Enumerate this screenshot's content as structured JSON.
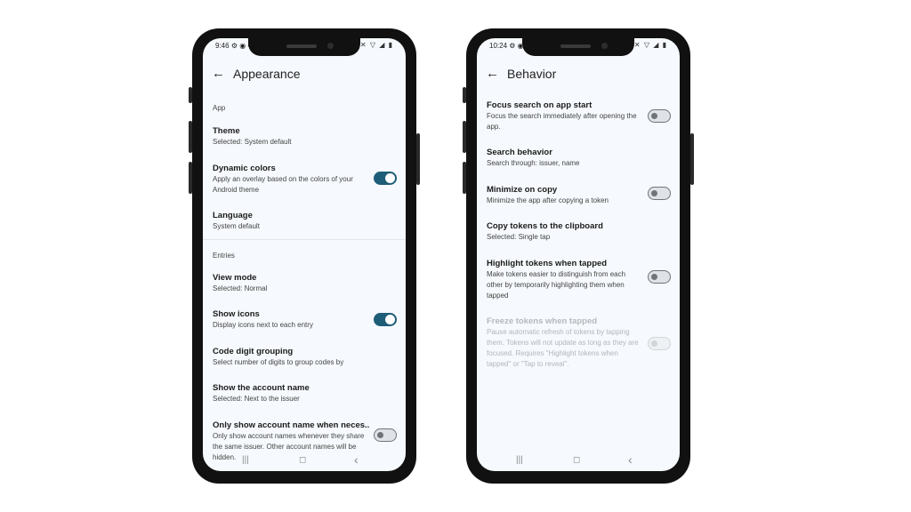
{
  "left_phone": {
    "status": {
      "time": "9:46",
      "left_icons": "⚙ ◉ •",
      "right_icons": "✕ ▽ ◢ ▮"
    },
    "title": "Appearance",
    "sections": {
      "app": "App",
      "entries": "Entries"
    },
    "items": [
      {
        "title": "Theme",
        "subtitle": "Selected: System default"
      },
      {
        "title": "Dynamic colors",
        "subtitle": "Apply an overlay based on the colors of your Android theme",
        "toggle": "on"
      },
      {
        "title": "Language",
        "subtitle": "System default"
      },
      {
        "title": "View mode",
        "subtitle": "Selected: Normal"
      },
      {
        "title": "Show icons",
        "subtitle": "Display icons next to each entry",
        "toggle": "on"
      },
      {
        "title": "Code digit grouping",
        "subtitle": "Select number of digits to group codes by"
      },
      {
        "title": "Show the account name",
        "subtitle": "Selected: Next to the issuer"
      },
      {
        "title": "Only show account name when neces..",
        "subtitle": "Only show account names whenever they share the same issuer. Other account names will be hidden.",
        "toggle": "off"
      }
    ]
  },
  "right_phone": {
    "status": {
      "time": "10:24",
      "left_icons": "⚙ ◉ •",
      "right_icons": "✕ ▽ ◢ ▮"
    },
    "title": "Behavior",
    "items": [
      {
        "title": "Focus search on app start",
        "subtitle": "Focus the search immediately after opening the app.",
        "toggle": "off"
      },
      {
        "title": "Search behavior",
        "subtitle": "Search through: issuer, name"
      },
      {
        "title": "Minimize on copy",
        "subtitle": "Minimize the app after copying a token",
        "toggle": "off"
      },
      {
        "title": "Copy tokens to the clipboard",
        "subtitle": "Selected: Single tap"
      },
      {
        "title": "Highlight tokens when tapped",
        "subtitle": "Make tokens easier to distinguish from each other by temporarily highlighting them when tapped",
        "toggle": "off"
      },
      {
        "title": "Freeze tokens when tapped",
        "subtitle": "Pause automatic refresh of tokens by tapping them. Tokens will not update as long as they are focused. Requires \"Highlight tokens when tapped\" or \"Tap to reveal\".",
        "toggle": "disabled"
      }
    ]
  },
  "nav": {
    "recents": "|||",
    "home": "◻",
    "back": "‹"
  },
  "icons": {
    "back": "arrow-left-icon"
  },
  "colors": {
    "accent": "#1e5d78",
    "screen_bg": "#f6f9fd",
    "frame": "#111111"
  }
}
